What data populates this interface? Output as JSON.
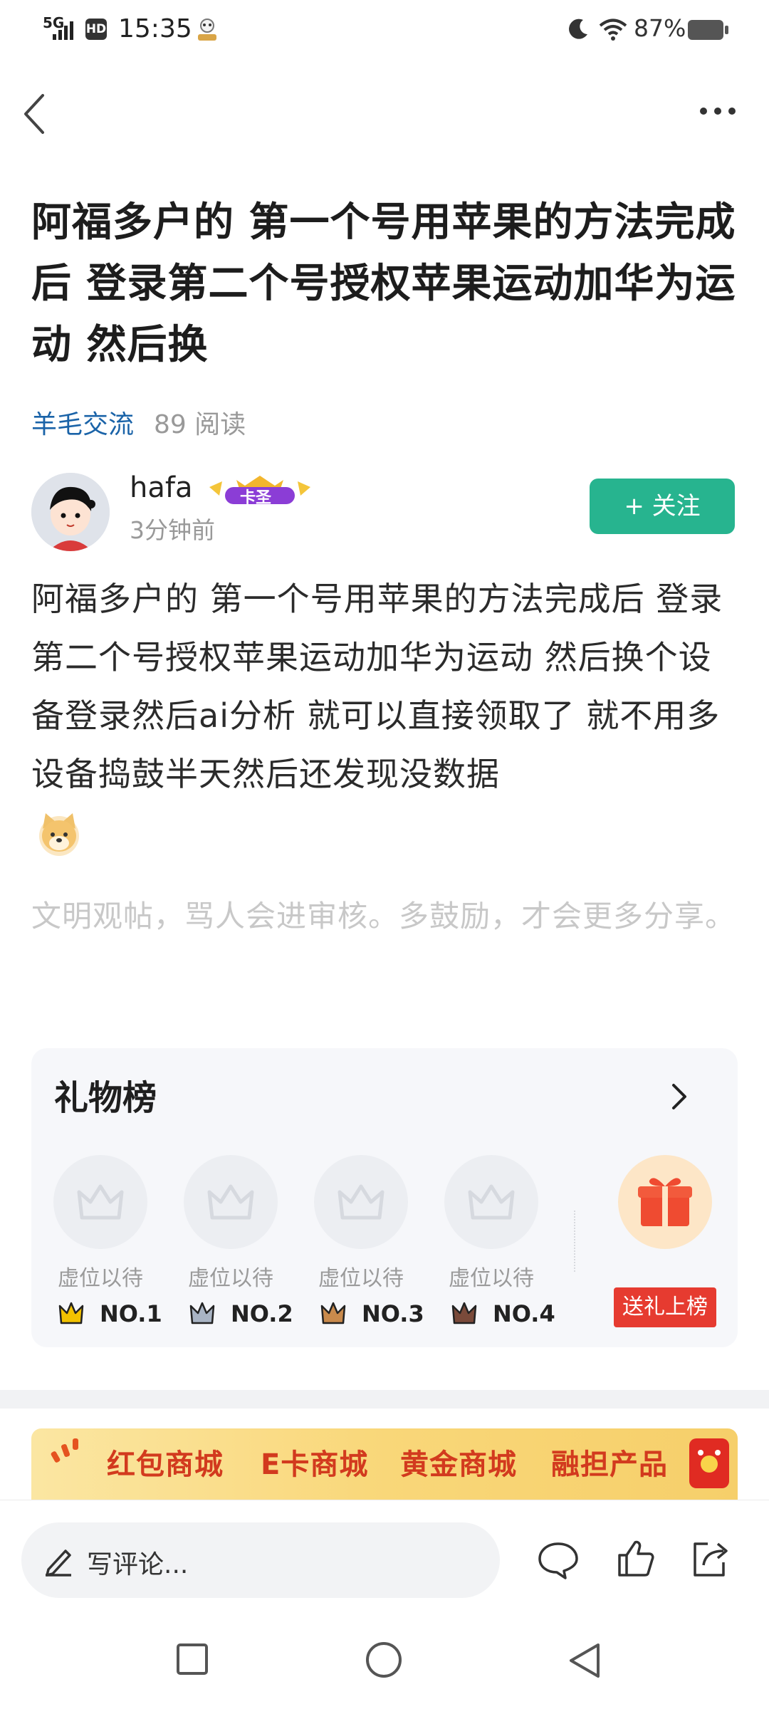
{
  "status_bar": {
    "signal": "5G",
    "hd": "HD",
    "time": "15:35",
    "battery": "87%"
  },
  "post": {
    "title": "阿福多户的 第一个号用苹果的方法完成后 登录第二个号授权苹果运动加华为运动 然后换",
    "category": "羊毛交流",
    "reads": "89 阅读",
    "author": "hafa",
    "author_badge": "卡圣",
    "time_ago": "3分钟前",
    "follow_label": "+ 关注",
    "body": "阿福多户的 第一个号用苹果的方法完成后 登录第二个号授权苹果运动加华为运动 然后换个设备登录然后ai分析   就可以直接领取了 就不用多设备捣鼓半天然后还发现没数据",
    "civility_hint": "文明观帖，骂人会进审核。多鼓励，才会更多分享。"
  },
  "gift_board": {
    "title": "礼物榜",
    "slots": [
      {
        "label": "虚位以待",
        "rank": "NO.1",
        "crown_color": "#f2c200"
      },
      {
        "label": "虚位以待",
        "rank": "NO.2",
        "crown_color": "#a9b4c4"
      },
      {
        "label": "虚位以待",
        "rank": "NO.3",
        "crown_color": "#c98a4c"
      },
      {
        "label": "虚位以待",
        "rank": "NO.4",
        "crown_color": "#7a4a3a"
      }
    ],
    "send_label": "送礼上榜"
  },
  "banner": {
    "items": [
      "红包商城",
      "E卡商城",
      "黄金商城",
      "融担产品"
    ]
  },
  "bottom_bar": {
    "comment_placeholder": "写评论..."
  },
  "colors": {
    "accent_green": "#27b48f",
    "link_blue": "#1a63a8",
    "send_red": "#e63b30"
  }
}
